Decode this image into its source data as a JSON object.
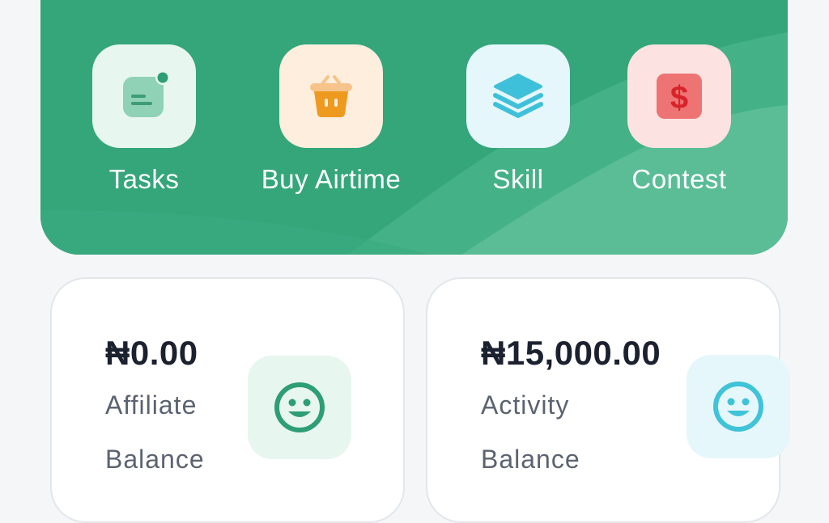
{
  "quick_actions": [
    {
      "label": "Tasks",
      "icon": "tasks-icon",
      "tile_color": "#e8f6f0",
      "icon_color": "#8fd2b6"
    },
    {
      "label": "Buy Airtime",
      "icon": "basket-icon",
      "tile_color": "#fdeede",
      "icon_color": "#ee9a1f"
    },
    {
      "label": "Skill",
      "icon": "layers-icon",
      "tile_color": "#e6f7fb",
      "icon_color": "#3fc0da"
    },
    {
      "label": "Contest",
      "icon": "dollar-icon",
      "tile_color": "#fde2e2",
      "icon_color": "#ee7474"
    }
  ],
  "balances": {
    "affiliate": {
      "amount": "₦0.00",
      "caption_line1": "Affiliate",
      "caption_line2": "Balance",
      "icon": "smile-icon",
      "icon_color": "#2e9e74"
    },
    "activity": {
      "amount": "₦15,000.00",
      "caption_line1": "Activity",
      "caption_line2": "Balance",
      "icon": "smile-icon",
      "icon_color": "#3fc3d8"
    }
  },
  "colors": {
    "hero_green": "#35a87c",
    "background": "#f4f6f8",
    "text_dark": "#1c2130",
    "text_muted": "#5b6370"
  }
}
